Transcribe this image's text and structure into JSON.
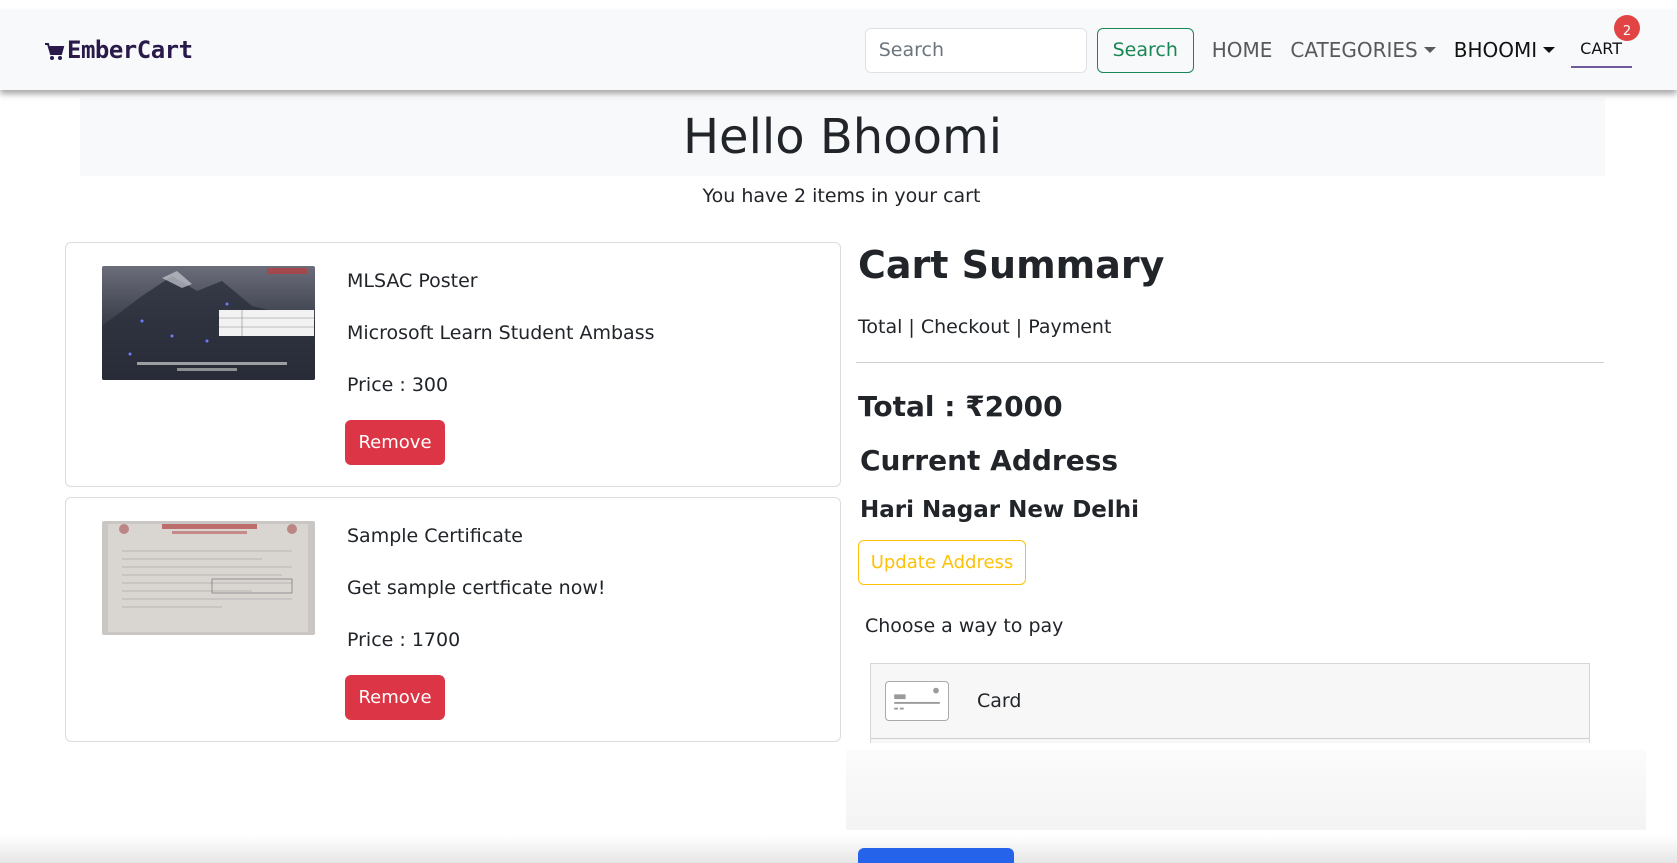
{
  "navbar": {
    "brand": "EmberCart",
    "search_placeholder": "Search",
    "search_button": "Search",
    "home": "HOME",
    "categories": "CATEGORIES",
    "user": "BHOOMI",
    "cart": "CART",
    "cart_count": "2"
  },
  "hero": {
    "title": "Hello Bhoomi",
    "subtitle": "You have 2 items in your cart"
  },
  "items": [
    {
      "name": "MLSAC Poster",
      "description": "Microsoft Learn Student Ambass",
      "price": "Price : 300",
      "remove": "Remove"
    },
    {
      "name": "Sample Certificate",
      "description": "Get sample certficate now!",
      "price": "Price : 1700",
      "remove": "Remove"
    }
  ],
  "summary": {
    "title": "Cart Summary",
    "links": "Total | Checkout | Payment",
    "total": "Total : ₹2000",
    "address_title": "Current Address",
    "address": "Hari Nagar New Delhi",
    "update_button": "Update Address",
    "pay_label": "Choose a way to pay",
    "payment_option": "Card"
  },
  "colors": {
    "danger": "#dc3545",
    "success": "#198754",
    "warning": "#ffc107",
    "primary": "#2563eb",
    "badge": "#e04444"
  },
  "icons": [
    "cart-icon",
    "caret-down-icon",
    "credit-card-icon"
  ]
}
